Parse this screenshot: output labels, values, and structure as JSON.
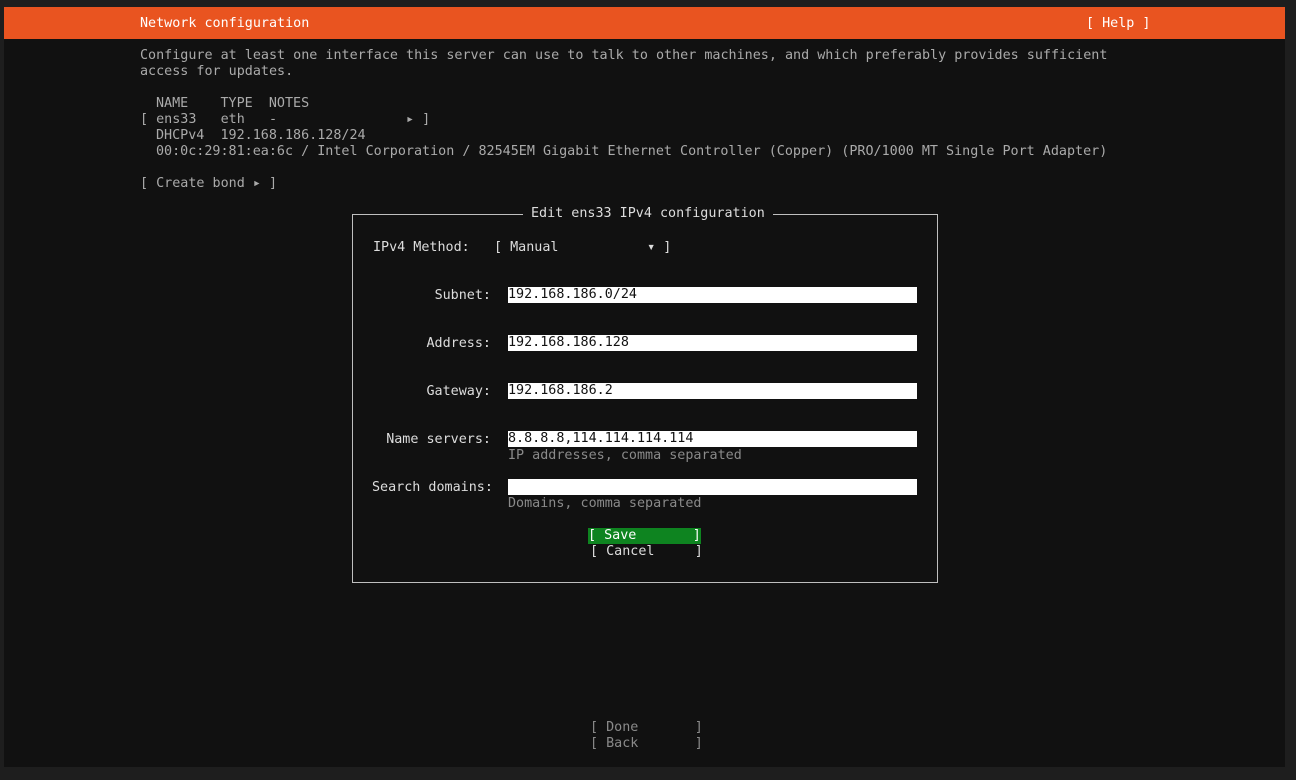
{
  "header": {
    "title": "Network configuration",
    "help": "[ Help ]",
    "bg_color": "#e95420"
  },
  "intro": {
    "line1": "Configure at least one interface this server can use to talk to other machines, and which preferably provides sufficient",
    "line2": "access for updates."
  },
  "table": {
    "headers": "NAME    TYPE  NOTES",
    "row_line": "[ ens33   eth   -                ▸ ]",
    "dhcp_line": "DHCPv4  192.168.186.128/24",
    "hw_line": "00:0c:29:81:ea:6c / Intel Corporation / 82545EM Gigabit Ethernet Controller (Copper) (PRO/1000 MT Single Port Adapter)"
  },
  "create_bond": "[ Create bond ▸ ]",
  "dialog": {
    "title": "Edit ens33 IPv4 configuration",
    "method_label": "IPv4 Method:",
    "method_value": "[ Manual           ▾ ]",
    "subnet_label": "Subnet:",
    "subnet_value": "192.168.186.0/24",
    "address_label": "Address:",
    "address_value": "192.168.186.128",
    "gateway_label": "Gateway:",
    "gateway_value": "192.168.186.2",
    "nameservers_label": "Name servers:",
    "nameservers_value": "8.8.8.8,114.114.114.114",
    "nameservers_hint": "IP addresses, comma separated",
    "searchdomains_label": "Search domains:",
    "searchdomains_value": "",
    "searchdomains_hint": "Domains, comma separated",
    "save": "[ Save       ]",
    "cancel": "[ Cancel     ]",
    "focus_color": "#0e8420"
  },
  "footer": {
    "done": "[ Done       ]",
    "back": "[ Back       ]"
  }
}
